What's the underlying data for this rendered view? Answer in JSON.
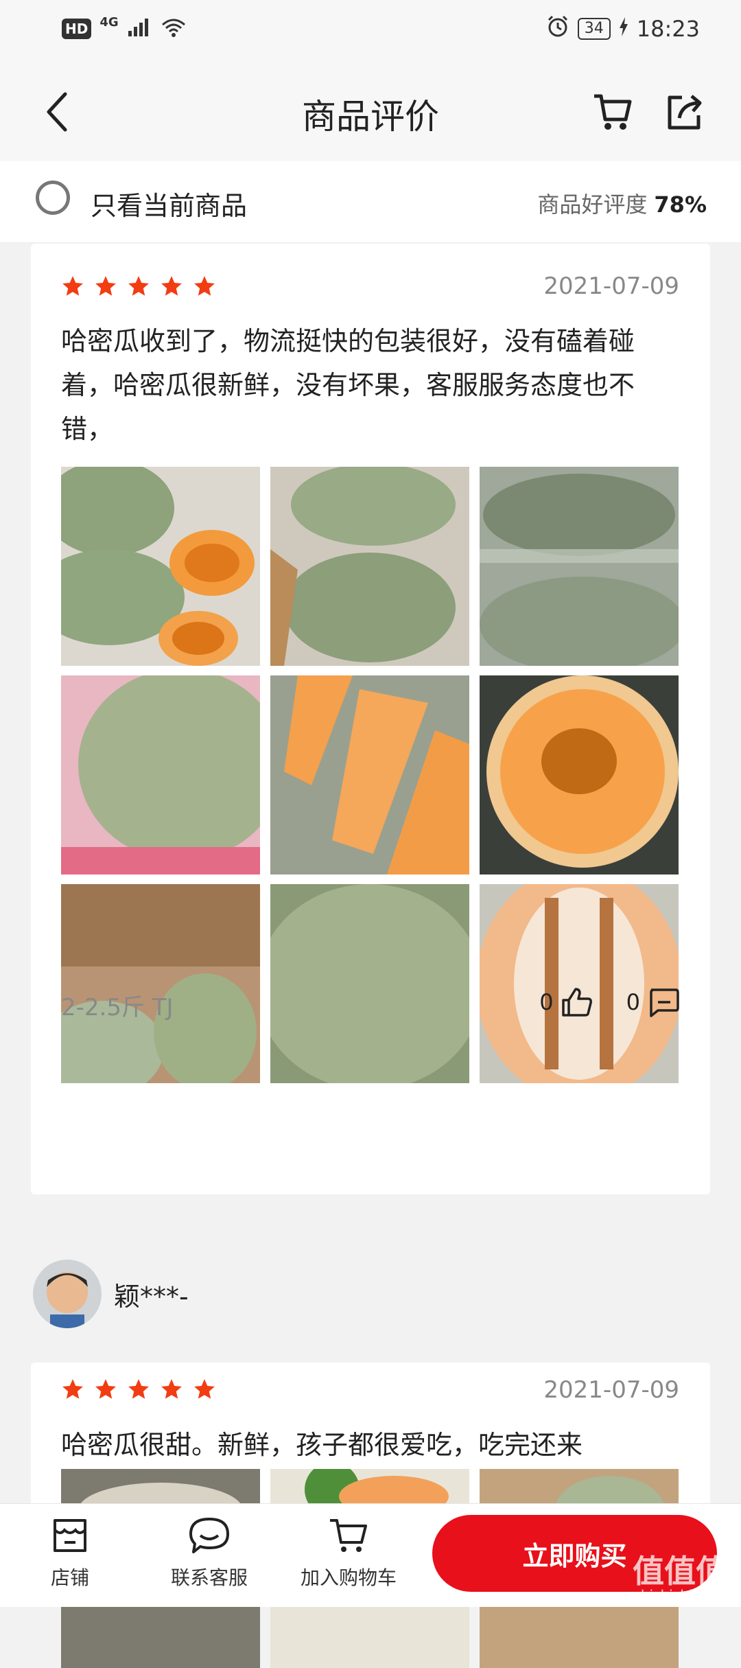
{
  "status_bar": {
    "hd": "HD",
    "network": "4G",
    "battery": "34",
    "time": "18:23"
  },
  "header": {
    "title": "商品评价"
  },
  "filter": {
    "label": "只看当前商品",
    "rating_label": "商品好评度",
    "rating_value": "78%"
  },
  "reviews": [
    {
      "stars": 5,
      "date": "2021-07-09",
      "text": "哈密瓜收到了，物流挺快的包装很好，没有磕着碰着，哈密瓜很新鲜，没有坏果，客服服务态度也不错，",
      "spec": "2-2.5斤 TJ",
      "likes": "0",
      "comments": "0"
    },
    {
      "user": "颖***-",
      "stars": 5,
      "date": "2021-07-09",
      "text": "哈密瓜很甜。新鲜，孩子都很爱吃，吃完还来"
    }
  ],
  "bottom_bar": {
    "store": "店铺",
    "service": "联系客服",
    "cart": "加入购物车",
    "buy": "立即购买"
  },
  "watermark": {
    "main": "值值值",
    "sub": "zhizhizhi.com"
  },
  "colors": {
    "accent": "#e8101a",
    "star": "#f23c12"
  }
}
